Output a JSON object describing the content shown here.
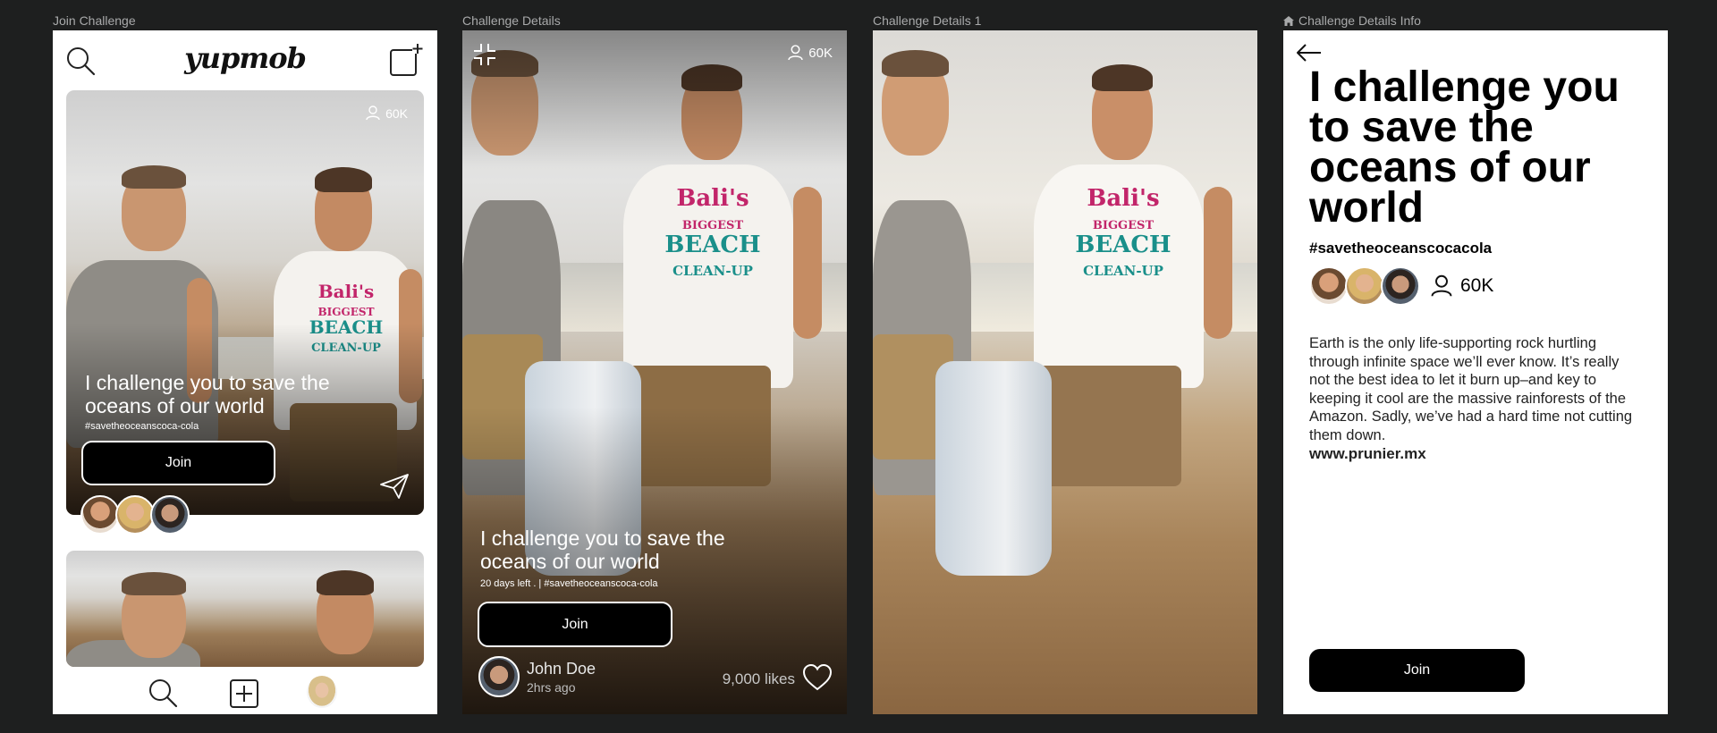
{
  "frames": {
    "join_challenge": {
      "label": "Join Challenge"
    },
    "challenge_details": {
      "label": "Challenge Details"
    },
    "challenge_details_1": {
      "label": "Challenge Details 1"
    },
    "challenge_details_info": {
      "label": "Challenge Details Info"
    }
  },
  "feed": {
    "logo": "yupmob",
    "card": {
      "participants": "60K",
      "title": "I challenge you to save the oceans of our world",
      "hashtag": "#savetheoceanscoca-cola",
      "join_label": "Join"
    }
  },
  "details": {
    "participants": "60K",
    "title": "I challenge you to save the oceans of our world",
    "meta": "20 days left .  |  #savetheoceanscoca-cola",
    "join_label": "Join",
    "user_name": "John Doe",
    "user_time": "2hrs ago",
    "likes": "9,000 likes"
  },
  "info": {
    "title": "I challenge you to save the oceans of our world",
    "hashtag": "#savetheoceanscocacola",
    "participants": "60K",
    "body": "Earth is the only life-supporting rock hurtling through infinite space we’ll ever know. It’s really not the best idea to let it burn up–and key to keeping it cool are the massive rainforests of the Amazon. Sadly, we’ve had a hard time not cutting them down.",
    "link": "www.prunier.mx",
    "join_label": "Join"
  },
  "icons": {
    "search": "search-icon",
    "new_post": "new-post-icon",
    "user": "user-icon",
    "send": "send-icon",
    "add": "add-icon",
    "collapse": "collapse-icon",
    "heart": "heart-icon",
    "back": "back-arrow-icon",
    "info_home": "home-icon"
  },
  "colors": {
    "background": "#1e1f1f",
    "primary": "#000000",
    "surface": "#ffffff",
    "label": "#a9aaab"
  }
}
